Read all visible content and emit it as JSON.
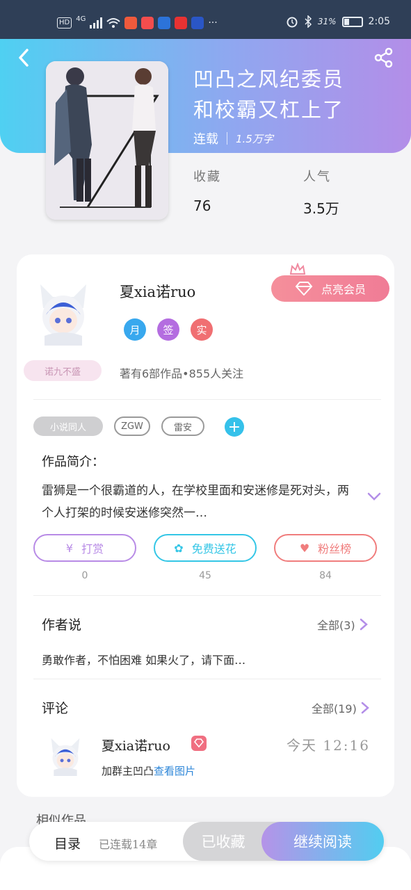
{
  "status_bar": {
    "hd": "HD",
    "network": "4G",
    "battery": "31%",
    "time": "2:05",
    "more": "···",
    "app_colors": [
      "#f05a3c",
      "#f44d4d",
      "#2c73d9",
      "#e73232",
      "#2a56c6"
    ]
  },
  "book": {
    "title_line1": "凹凸之风纪委员",
    "title_line2": "和校霸又杠上了",
    "status": "连载",
    "word_count": "1.5万字",
    "favorites_label": "收藏",
    "favorites_value": "76",
    "popularity_label": "人气",
    "popularity_value": "3.5万"
  },
  "author": {
    "name": "夏xia诺ruo",
    "vip_button": "点亮会员",
    "badges": [
      {
        "glyph": "月",
        "color": "#38a8ee"
      },
      {
        "glyph": "签",
        "color": "#b46de0"
      },
      {
        "glyph": "实",
        "color": "#f06f72"
      }
    ],
    "tag": "诺九不盛",
    "stats": "著有6部作品•855人关注"
  },
  "tags": [
    "小说同人",
    "ZGW",
    "雷安"
  ],
  "tag_add": "+",
  "synopsis": {
    "heading": "作品简介：",
    "text": "雷狮是一个很霸道的人，在学校里面和安迷修是死对头，两个人打架的时候安迷修突然一…"
  },
  "actions": [
    {
      "label": "打赏",
      "count": "0",
      "color": "#b88be6",
      "icon": "¥"
    },
    {
      "label": "免费送花",
      "count": "45",
      "color": "#34c6e6",
      "icon": "✿"
    },
    {
      "label": "粉丝榜",
      "count": "84",
      "color": "#f07d7d",
      "icon": "♥"
    }
  ],
  "author_says": {
    "heading": "作者说",
    "more": "全部(3)",
    "text": "勇敢作者，不怕困难 如果火了，请下面…"
  },
  "comments": {
    "heading": "评论",
    "more": "全部(19)",
    "items": [
      {
        "name": "夏xia诺ruo",
        "time": "今天 12:16",
        "text": "加群主凹凸",
        "link": "查看图片"
      }
    ]
  },
  "similar_heading": "相似作品",
  "bottom_bar": {
    "toc": "目录",
    "toc_info": "已连载14章",
    "favorited": "已收藏",
    "continue": "继续阅读"
  }
}
